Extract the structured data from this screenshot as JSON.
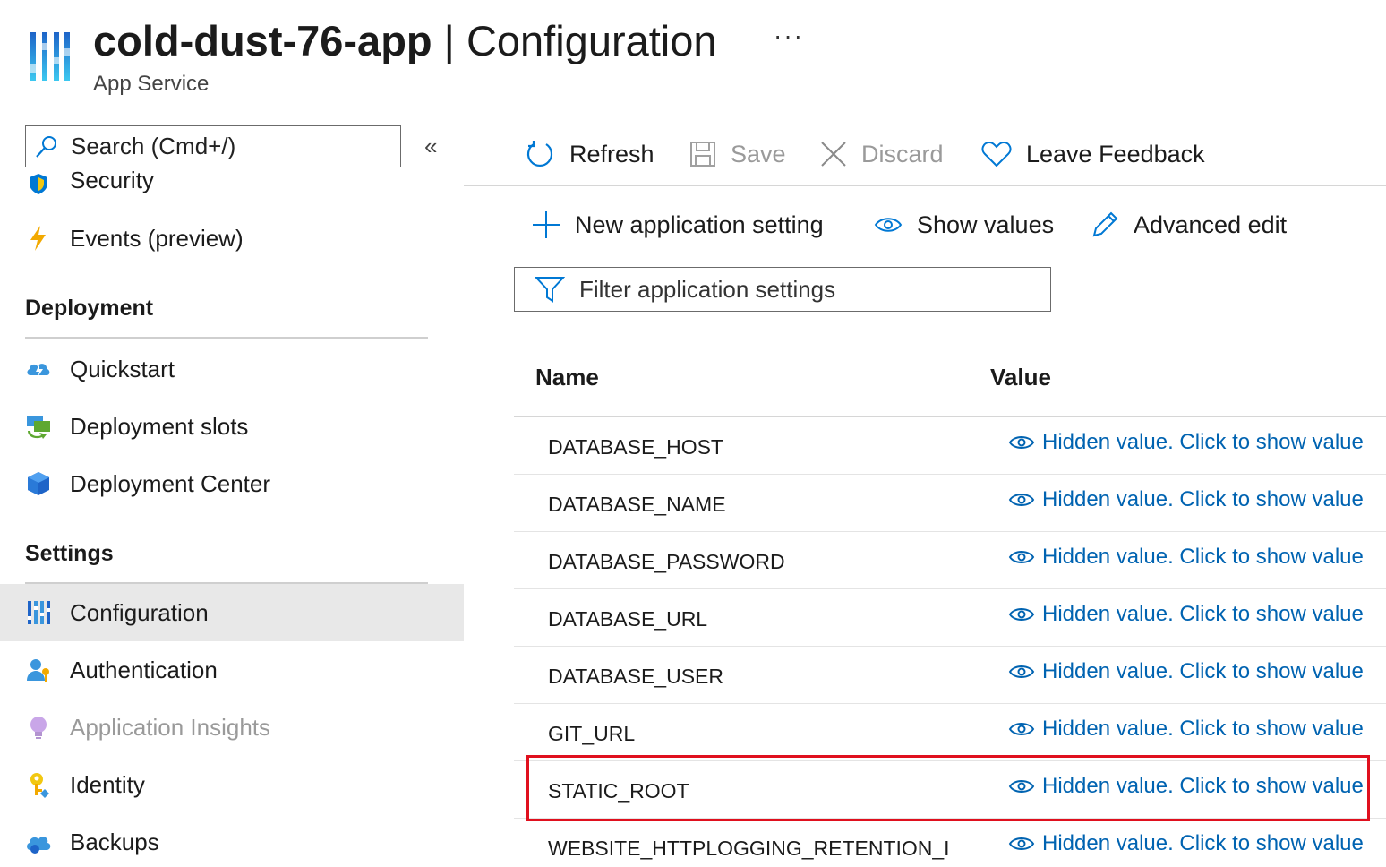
{
  "header": {
    "resource_name": "cold-dust-76-app",
    "separator": " | ",
    "blade_title": "Configuration",
    "subtitle": "App Service",
    "more_label": "···"
  },
  "sidebar": {
    "search_placeholder": "Search (Cmd+/)",
    "collapse_label": "«",
    "partial_item": "Security",
    "items_top": [
      {
        "label": "Events (preview)",
        "icon": "lightning-icon"
      }
    ],
    "sections": [
      {
        "title": "Deployment",
        "items": [
          {
            "label": "Quickstart",
            "icon": "cloud-quickstart-icon"
          },
          {
            "label": "Deployment slots",
            "icon": "deployment-slots-icon"
          },
          {
            "label": "Deployment Center",
            "icon": "cube-icon"
          }
        ]
      },
      {
        "title": "Settings",
        "items": [
          {
            "label": "Configuration",
            "icon": "configuration-icon",
            "active": true
          },
          {
            "label": "Authentication",
            "icon": "user-key-icon"
          },
          {
            "label": "Application Insights",
            "icon": "lightbulb-icon",
            "disabled": true
          },
          {
            "label": "Identity",
            "icon": "key-icon"
          },
          {
            "label": "Backups",
            "icon": "cloud-backup-icon"
          }
        ]
      }
    ]
  },
  "toolbar": {
    "refresh": "Refresh",
    "save": "Save",
    "discard": "Discard",
    "feedback": "Leave Feedback"
  },
  "commands": {
    "new_setting": "New application setting",
    "show_values": "Show values",
    "advanced_edit": "Advanced edit"
  },
  "filter": {
    "placeholder": "Filter application settings"
  },
  "grid": {
    "columns": [
      "Name",
      "Value"
    ],
    "hidden_text": "Hidden value. Click to show value",
    "rows": [
      "DATABASE_HOST",
      "DATABASE_NAME",
      "DATABASE_PASSWORD",
      "DATABASE_URL",
      "DATABASE_USER",
      "GIT_URL",
      "STATIC_ROOT",
      "WEBSITE_HTTPLOGGING_RETENTION_I"
    ]
  },
  "colors": {
    "link": "#0063b1",
    "accent_blue": "#0078d4",
    "highlight": "#e0101e"
  }
}
